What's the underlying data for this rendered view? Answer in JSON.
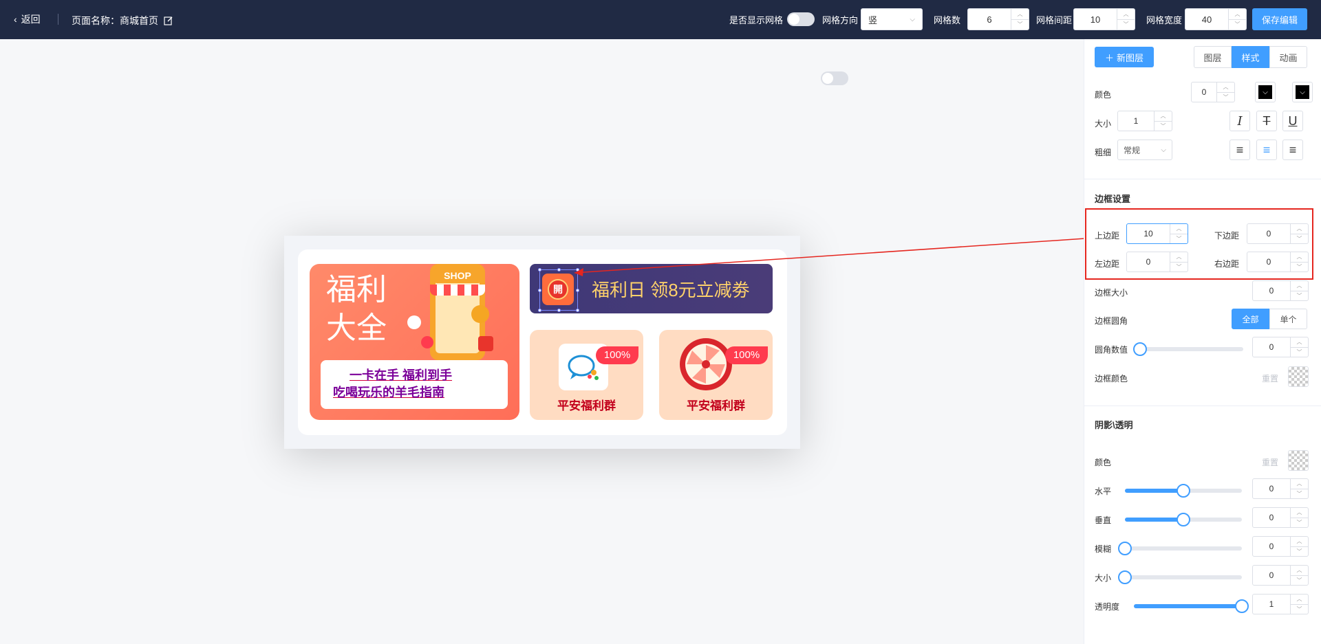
{
  "topbar": {
    "back_label": "返回",
    "page_name": "页面名称：商城首页",
    "show_grid_label": "是否显示网格",
    "grid_direction_label": "网格方向",
    "grid_direction_value": "竖",
    "grid_count_label": "网格数",
    "grid_count_value": "6",
    "grid_gap_label": "网格间距",
    "grid_gap_value": "10",
    "grid_width_label": "网格宽度",
    "grid_width_value": "40",
    "save_label": "保存编辑"
  },
  "canvas": {
    "big_tile_title_1": "福利",
    "big_tile_title_2": "大全",
    "shop_sign": "SHOP",
    "note_line_1": "一卡在手 福利到手",
    "note_line_2": "吃喝玩乐的羊毛指南",
    "banner_badge": "開",
    "banner_text": "福利日 领8元立减劵",
    "tile_left_pct": "100%",
    "tile_left_label": "平安福利群",
    "tile_right_pct": "100%",
    "tile_right_label": "平安福利群"
  },
  "panel": {
    "new_layer_label": "新图层",
    "tabs": [
      "图层",
      "样式",
      "动画"
    ],
    "active_tab": "样式",
    "color_label": "颜色",
    "color_value": "0",
    "size_label": "大小",
    "size_value": "1",
    "weight_label": "粗细",
    "weight_value": "常规",
    "border_section": "边框设置",
    "top_margin_label": "上边距",
    "top_margin_value": "10",
    "bottom_margin_label": "下边距",
    "bottom_margin_value": "0",
    "left_margin_label": "左边距",
    "left_margin_value": "0",
    "right_margin_label": "右边距",
    "right_margin_value": "0",
    "border_size_label": "边框大小",
    "border_size_value": "0",
    "border_radius_label": "边框圆角",
    "radius_all": "全部",
    "radius_single": "单个",
    "radius_value_label": "圆角数值",
    "radius_value": "0",
    "border_color_label": "边框颜色",
    "reset_label": "重置",
    "shadow_section": "阴影\\透明",
    "shadow_color_label": "颜色",
    "horizontal_label": "水平",
    "horizontal_value": "0",
    "vertical_label": "垂直",
    "vertical_value": "0",
    "blur_label": "模糊",
    "blur_value": "0",
    "shadow_size_label": "大小",
    "shadow_size_value": "0",
    "opacity_label": "透明度",
    "opacity_value": "1",
    "sliders": {
      "radius": 0,
      "horizontal": 0.5,
      "vertical": 0.5,
      "blur": 0,
      "size": 0,
      "opacity": 1
    }
  },
  "colors": {
    "topbar_bg": "#202a44",
    "accent": "#409eff",
    "highlight_red": "#e5261f"
  }
}
